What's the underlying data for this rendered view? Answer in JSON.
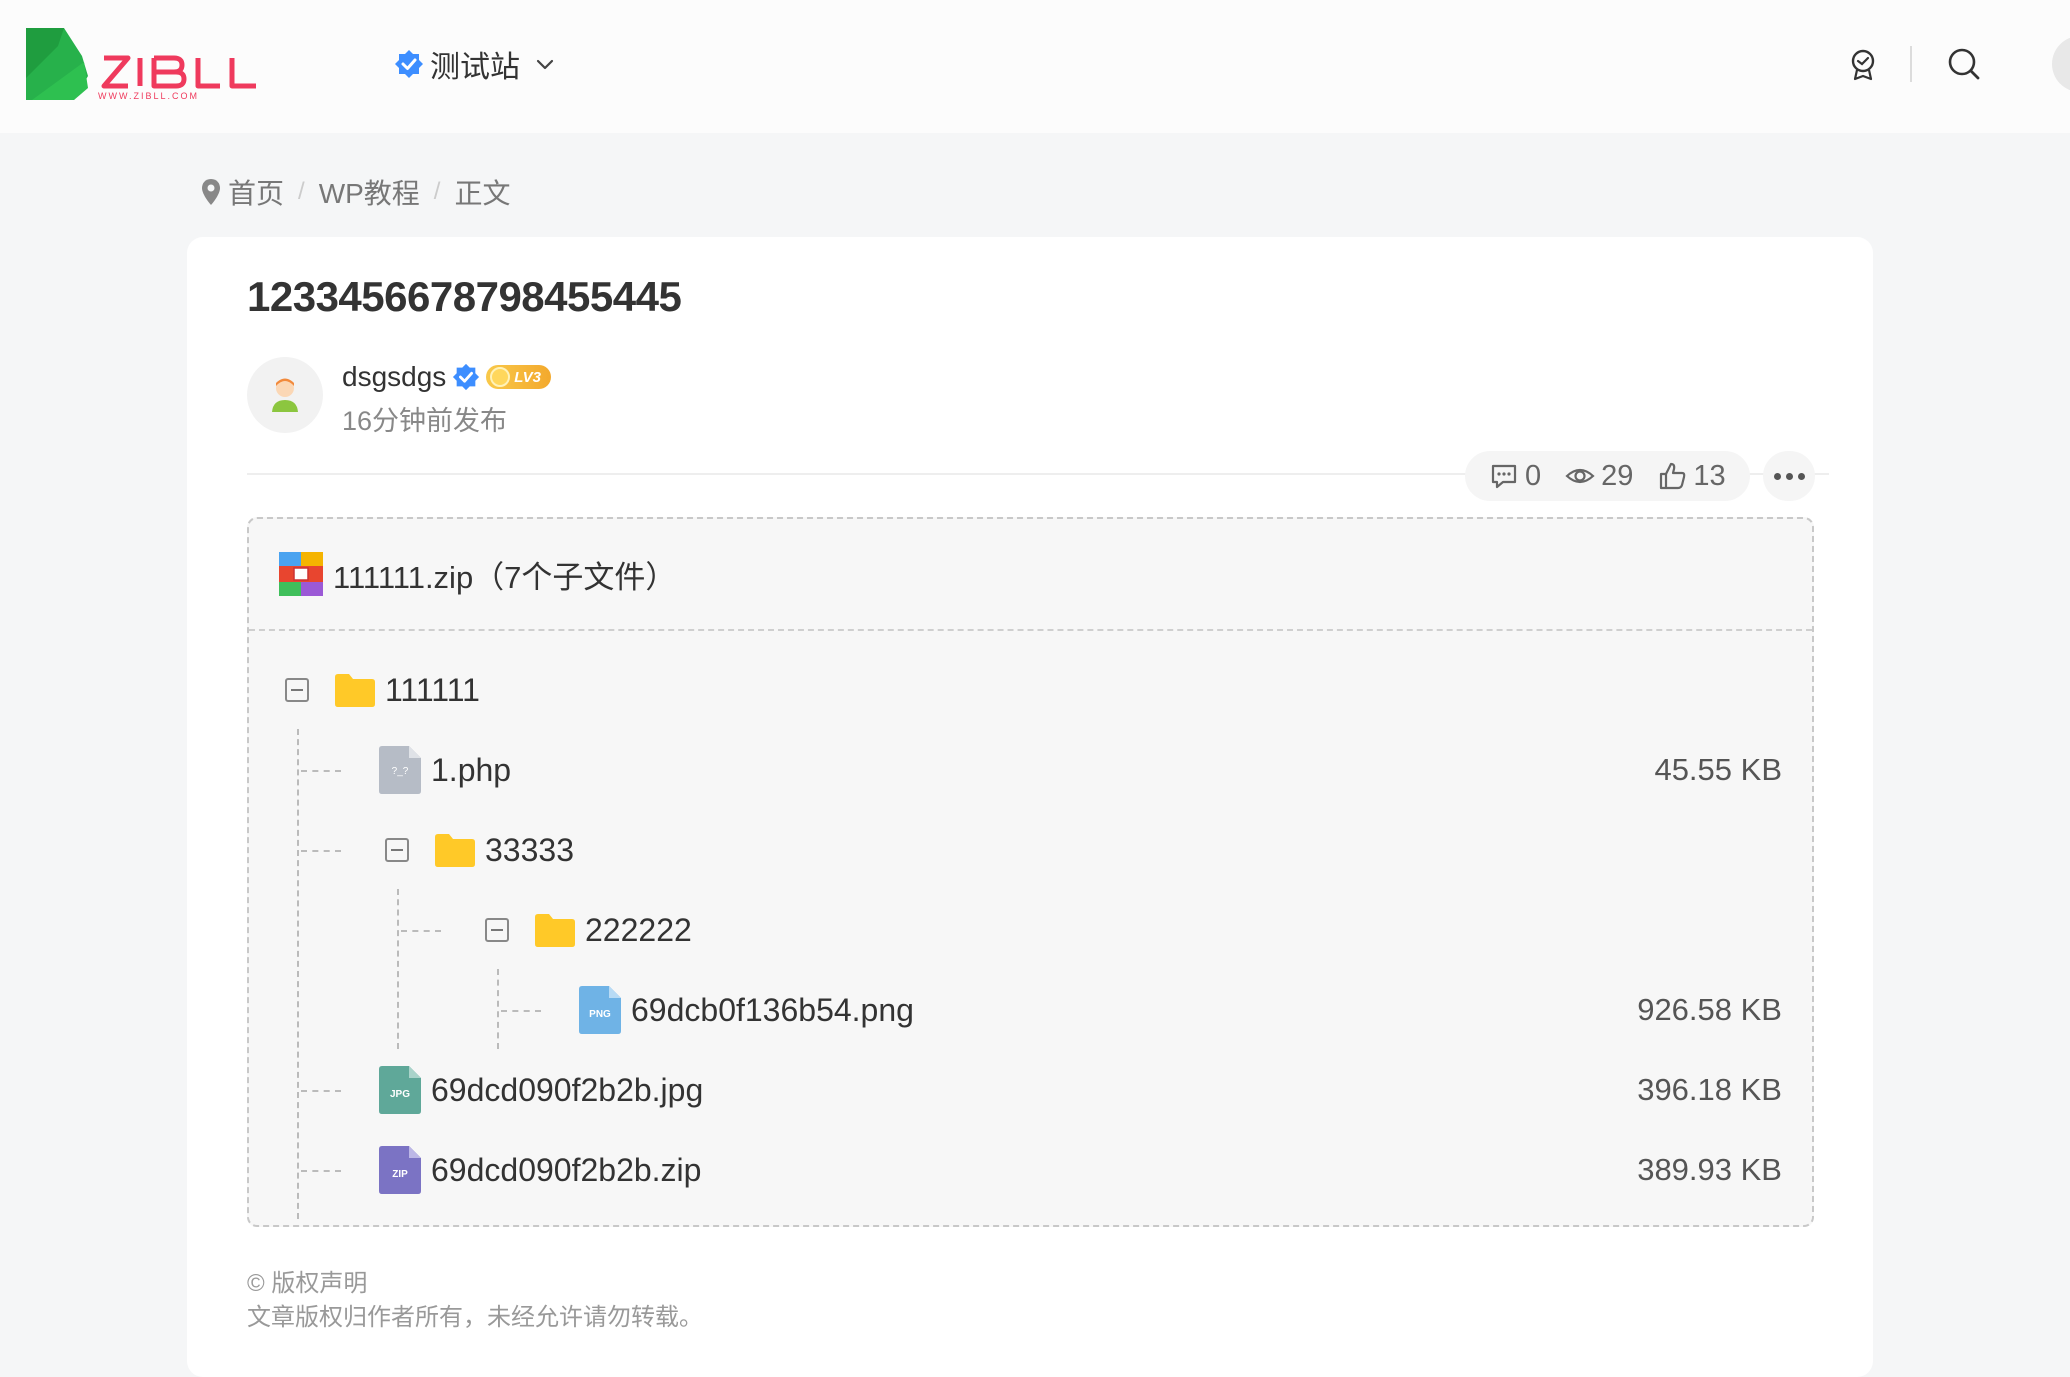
{
  "header": {
    "logo_alt": "ZIBLL",
    "logo_sub": "WWW.ZIBLL.COM",
    "site_name": "测试站",
    "colors": {
      "brand_green": "#27b14b",
      "brand_red": "#ef3a5d",
      "verify_blue": "#3d8eff"
    },
    "icons": [
      "verified-icon",
      "chevron-down-icon",
      "badge-icon",
      "search-icon"
    ]
  },
  "breadcrumb": {
    "items": [
      "首页",
      "WP教程",
      "正文"
    ]
  },
  "post": {
    "title": "1233456678798455445",
    "author": "dsgsdgs",
    "level": "LV3",
    "time": "16分钟前发布",
    "stats": {
      "comments": "0",
      "views": "29",
      "likes": "13"
    }
  },
  "zip": {
    "title": "111111.zip（7个子文件）",
    "tree": [
      {
        "name": "111111",
        "type": "folder",
        "size": ""
      },
      {
        "name": "1.php",
        "type": "file",
        "ext": "?_?",
        "size": "45.55 KB"
      },
      {
        "name": "33333",
        "type": "folder",
        "size": ""
      },
      {
        "name": "222222",
        "type": "folder",
        "size": ""
      },
      {
        "name": "69dcb0f136b54.png",
        "type": "file",
        "ext": "PNG",
        "size": "926.58 KB"
      },
      {
        "name": "69dcd090f2b2b.jpg",
        "type": "file",
        "ext": "JPG",
        "size": "396.18 KB"
      },
      {
        "name": "69dcd090f2b2b.zip",
        "type": "file",
        "ext": "ZIP",
        "size": "389.93 KB"
      }
    ]
  },
  "copyright": {
    "heading": "© 版权声明",
    "text": "文章版权归作者所有，未经允许请勿转载。"
  }
}
